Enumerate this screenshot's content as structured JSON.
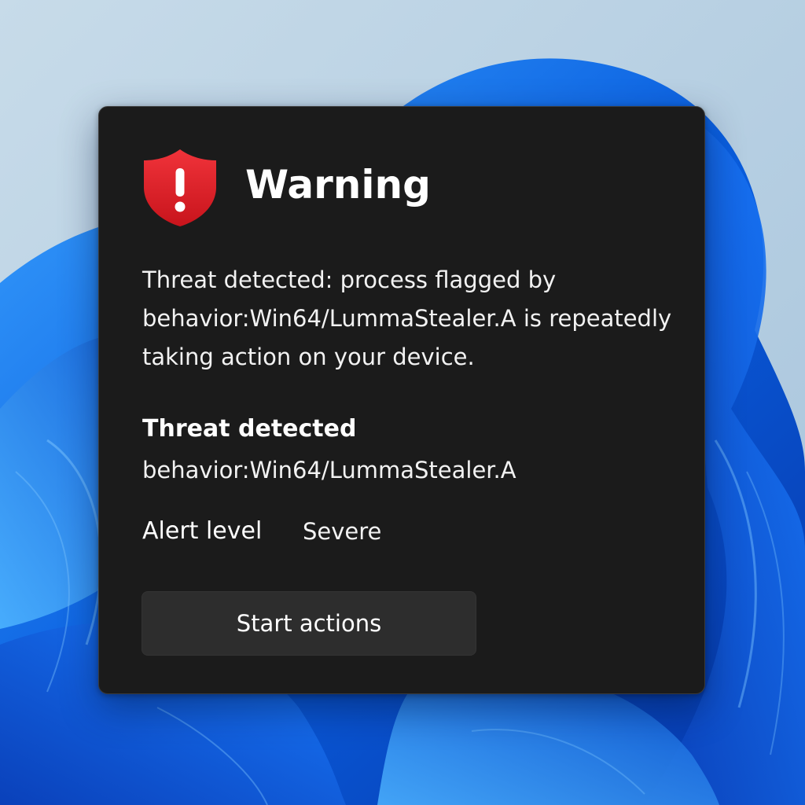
{
  "colors": {
    "dialog_background": "#1b1b1b",
    "button_background": "#2d2d2d",
    "shield_red": "#e3242b",
    "wallpaper_blue": "#0a5fe0"
  },
  "dialog": {
    "icon": "shield-exclamation-icon",
    "title": "Warning",
    "message": "Threat detected: process flagged by behavior:Win64/LummaStealer.A is repeatedly taking action on your device.",
    "threat": {
      "heading": "Threat detected",
      "name": "behavior:Win64/LummaStealer.A"
    },
    "alert": {
      "label": "Alert level",
      "value": "Severe"
    },
    "action_button_label": "Start actions"
  }
}
